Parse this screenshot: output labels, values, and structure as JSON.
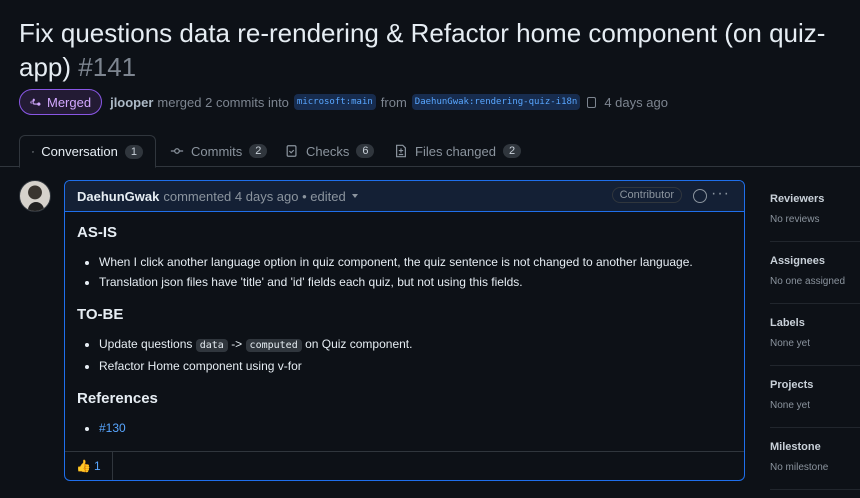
{
  "pr": {
    "title": "Fix questions data re-rendering & Refactor home component (on quiz-app)",
    "number": "#141",
    "state": "Merged",
    "author": "jlooper",
    "merged_text": "merged 2 commits into",
    "base_branch": "microsoft:main",
    "from_text": "from",
    "head_branch": "DaehunGwak:rendering-quiz-i18n",
    "time": "4 days ago"
  },
  "tabs": [
    {
      "label": "Conversation",
      "count": "1"
    },
    {
      "label": "Commits",
      "count": "2"
    },
    {
      "label": "Checks",
      "count": "6"
    },
    {
      "label": "Files changed",
      "count": "2"
    }
  ],
  "comment": {
    "author": "DaehunGwak",
    "meta": "commented 4 days ago • edited",
    "role": "Contributor",
    "sections": {
      "asis_heading": "AS-IS",
      "asis_1": "When I click another language option in quiz component, the quiz sentence is not changed to another language.",
      "asis_2": "Translation json files have 'title' and 'id' fields each quiz, but not using this fields.",
      "tobe_heading": "TO-BE",
      "tobe_1_a": "Update questions",
      "tobe_1_code1": "data",
      "tobe_1_b": "->",
      "tobe_1_code2": "computed",
      "tobe_1_c": "on Quiz component.",
      "tobe_2": "Refactor Home component using v-for",
      "refs_heading": "References",
      "ref_1": "#130"
    },
    "reaction_emoji": "👍",
    "reaction_count": "1"
  },
  "sidebar": [
    {
      "title": "Reviewers",
      "value": "No reviews"
    },
    {
      "title": "Assignees",
      "value": "No one assigned"
    },
    {
      "title": "Labels",
      "value": "None yet"
    },
    {
      "title": "Projects",
      "value": "None yet"
    },
    {
      "title": "Milestone",
      "value": "No milestone"
    }
  ]
}
